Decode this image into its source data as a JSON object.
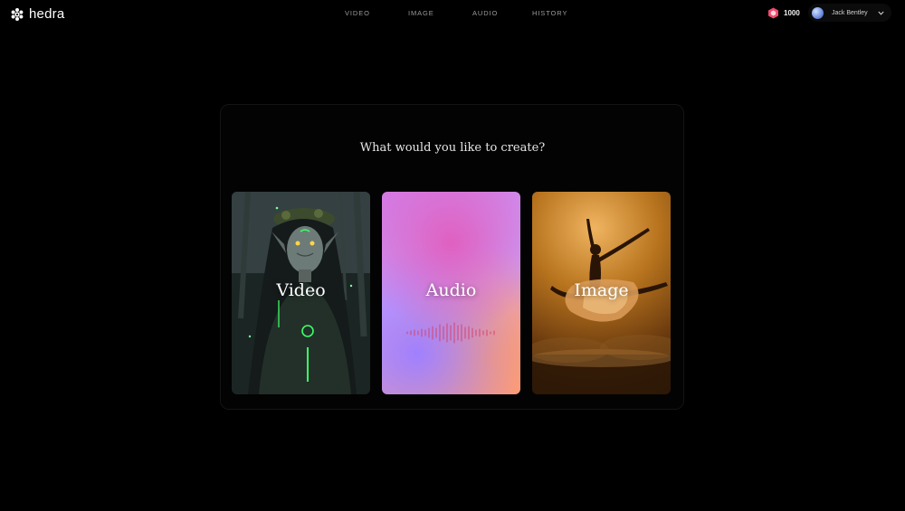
{
  "app": {
    "brand": "hedra"
  },
  "nav": {
    "items": [
      "VIDEO",
      "IMAGE",
      "AUDIO",
      "HISTORY"
    ]
  },
  "account": {
    "credits": "1000",
    "user_name": "Jack Bentley"
  },
  "main": {
    "prompt": "What would you like to create?",
    "cards": [
      {
        "label": "Video"
      },
      {
        "label": "Audio"
      },
      {
        "label": "Image"
      }
    ]
  },
  "colors": {
    "background": "#000000",
    "credit_gem": "#f04a6a",
    "nav_text": "#9a9a9a"
  }
}
